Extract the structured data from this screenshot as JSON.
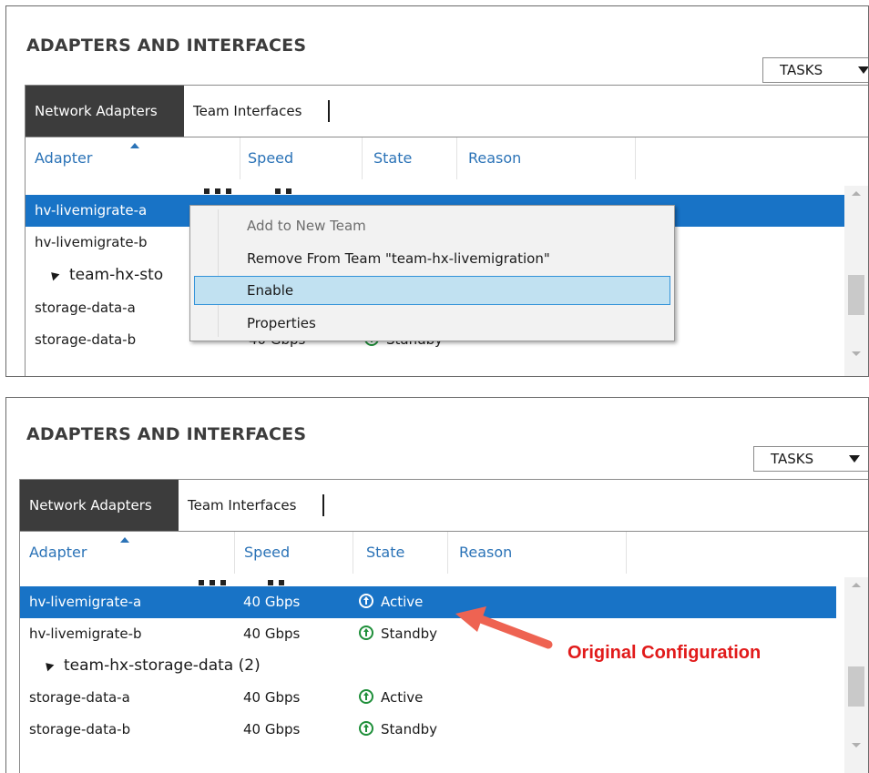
{
  "panel_title": "ADAPTERS AND INTERFACES",
  "tasks_label": "TASKS",
  "tabs": [
    "Network Adapters",
    "Team Interfaces"
  ],
  "columns": [
    "Adapter",
    "Speed",
    "State",
    "Reason"
  ],
  "context_menu": {
    "items": [
      {
        "label": "Add to New Team",
        "disabled": true
      },
      {
        "label": "Remove From Team \"team-hx-livemigration\"",
        "disabled": false
      },
      {
        "label": "Enable",
        "highlighted": true
      },
      {
        "label": "Properties",
        "disabled": false
      }
    ]
  },
  "top": {
    "rows": [
      {
        "adapter": "hv-livemigrate-a",
        "speed": "",
        "state": "",
        "selected": true
      },
      {
        "adapter": "hv-livemigrate-b",
        "speed": "",
        "state": ""
      },
      {
        "adapter": "team-hx-sto",
        "group": true
      },
      {
        "adapter": "storage-data-a",
        "speed": "",
        "state": ""
      },
      {
        "adapter": "storage-data-b",
        "speed": "40 Gbps",
        "state": "Standby"
      }
    ]
  },
  "bottom": {
    "rows": [
      {
        "adapter": "hv-livemigrate-a",
        "speed": "40 Gbps",
        "state": "Active",
        "selected": true
      },
      {
        "adapter": "hv-livemigrate-b",
        "speed": "40 Gbps",
        "state": "Standby"
      },
      {
        "adapter": "team-hx-storage-data (2)",
        "group": true
      },
      {
        "adapter": "storage-data-a",
        "speed": "40 Gbps",
        "state": "Active"
      },
      {
        "adapter": "storage-data-b",
        "speed": "40 Gbps",
        "state": "Standby"
      }
    ]
  },
  "callout": "Original Configuration",
  "colors": {
    "selection": "#1873c6",
    "header_text": "#2b73b7",
    "state_green": "#1f8f3a",
    "callout_red": "#e11a1a",
    "arrow": "#ee6352"
  }
}
